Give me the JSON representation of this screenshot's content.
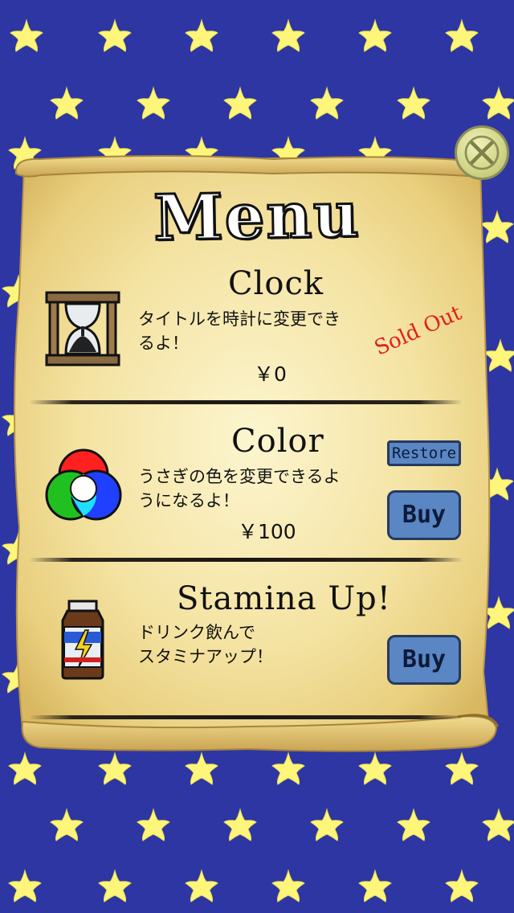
{
  "title": "Menu",
  "close_button": {
    "icon": "close-x-icon"
  },
  "items": [
    {
      "name": "Clock",
      "description": "タイトルを時計に変更でき\nるよ！",
      "price": "￥0",
      "status": "Sold Out",
      "icon": "hourglass-icon"
    },
    {
      "name": "Color",
      "description": "うさぎの色を変更できるよ\nうになるよ！",
      "price": "￥100",
      "restore_label": "Restore",
      "buy_label": "Buy",
      "icon": "color-circles-icon"
    },
    {
      "name": "Stamina Up!",
      "description": "ドリンク飲んで\nスタミナアップ！",
      "buy_label": "Buy",
      "icon": "energy-drink-icon"
    }
  ],
  "colors": {
    "background": "#2d36a3",
    "star": "#fdf67a",
    "parchment": "#f6e7a8",
    "button": "#5a86c4",
    "sold_out": "#e02020"
  }
}
